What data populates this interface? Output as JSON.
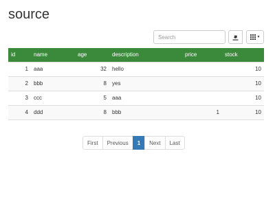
{
  "page": {
    "title": "source"
  },
  "toolbar": {
    "search_placeholder": "Search",
    "export_icon": "export-icon",
    "columns_icon": "grid-icon"
  },
  "table": {
    "headers": [
      "id",
      "name",
      "age",
      "description",
      "price",
      "stock"
    ],
    "rows": [
      {
        "id": "1",
        "name": "aaa",
        "age": "32",
        "description": "hello",
        "price": "",
        "stock": "10"
      },
      {
        "id": "2",
        "name": "bbb",
        "age": "8",
        "description": "yes",
        "price": "",
        "stock": "10"
      },
      {
        "id": "3",
        "name": "ccc",
        "age": "5",
        "description": "aaa",
        "price": "",
        "stock": "10"
      },
      {
        "id": "4",
        "name": "ddd",
        "age": "8",
        "description": "bbb",
        "price": "1",
        "stock": "10"
      }
    ]
  },
  "pagination": {
    "first": "First",
    "previous": "Previous",
    "current": "1",
    "next": "Next",
    "last": "Last",
    "active_color": "#337ab7"
  },
  "colors": {
    "header_bg": "#3b8a3b",
    "header_text": "#ffffff"
  }
}
